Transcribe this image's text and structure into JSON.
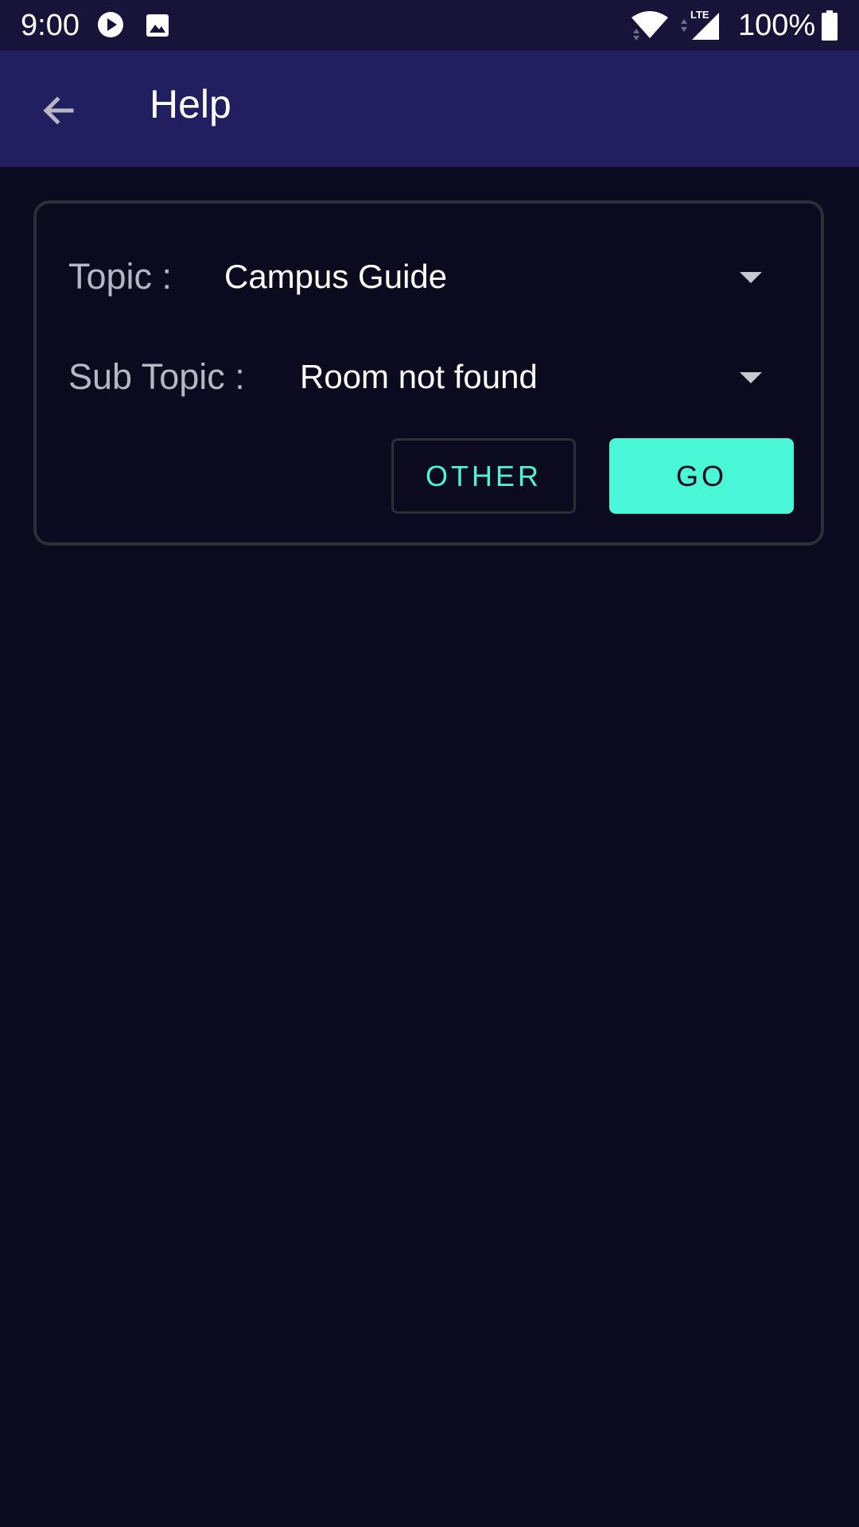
{
  "status_bar": {
    "time": "9:00",
    "network": "LTE",
    "battery": "100%",
    "icons": [
      "play-icon",
      "image-icon",
      "wifi-icon",
      "signal-icon",
      "battery-icon"
    ]
  },
  "app_bar": {
    "title": "Help",
    "back_icon": "arrow-left-icon"
  },
  "form": {
    "topic_label": "Topic :",
    "topic_value": "Campus Guide",
    "subtopic_label": "Sub Topic :",
    "subtopic_value": "Room not found",
    "other_button": "OTHER",
    "go_button": "GO"
  },
  "colors": {
    "background": "#0b0a1f",
    "status_bar": "#181439",
    "app_bar": "#221f61",
    "accent": "#4af7d6",
    "card_border": "#2f2e38"
  }
}
